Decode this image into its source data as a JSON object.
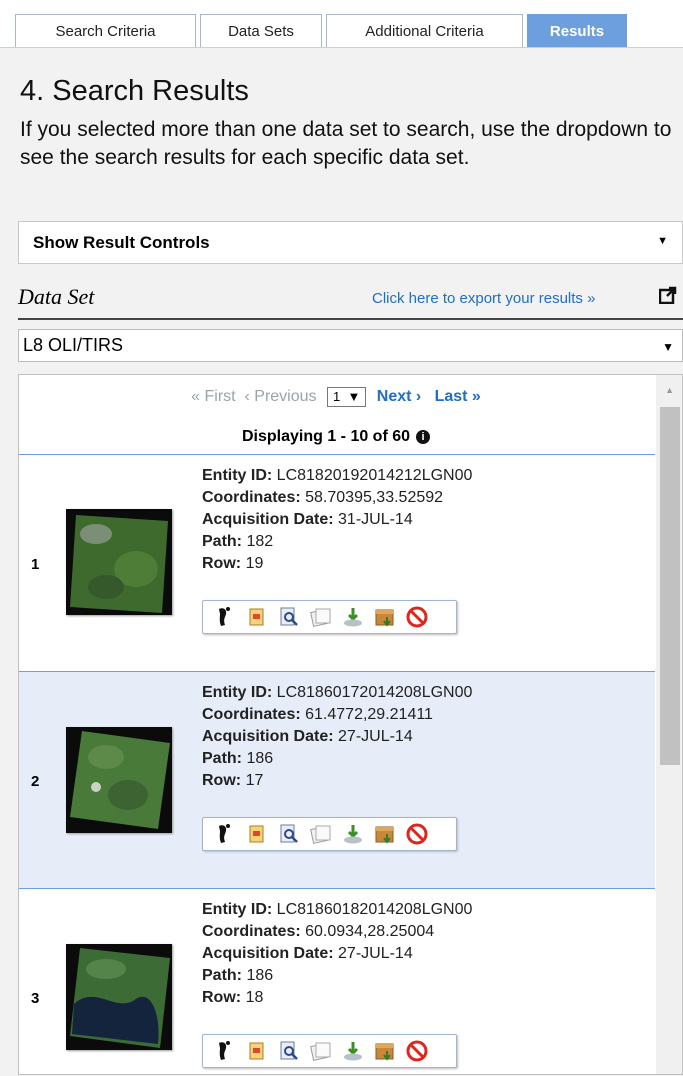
{
  "tabs": [
    {
      "label": "Search Criteria",
      "active": false
    },
    {
      "label": "Data Sets",
      "active": false
    },
    {
      "label": "Additional Criteria",
      "active": false
    },
    {
      "label": "Results",
      "active": true
    }
  ],
  "section": {
    "title": "4. Search Results",
    "description": "If you selected more than one data set to search, use the dropdown to see the search results for each specific data set."
  },
  "controls": {
    "label": "Show Result Controls"
  },
  "dataset": {
    "label": "Data Set",
    "export_link": "Click here to export your results »",
    "selected": "L8 OLI/TIRS"
  },
  "pager": {
    "first": "« First",
    "previous": "‹ Previous",
    "page": "1",
    "next": "Next ›",
    "last": "Last »",
    "displaying": "Displaying 1 - 10 of 60"
  },
  "field_labels": {
    "entity": "Entity ID:",
    "coordinates": "Coordinates:",
    "date": "Acquisition Date:",
    "path": "Path:",
    "row": "Row:"
  },
  "results": [
    {
      "num": "1",
      "entity_id": "LC81820192014212LGN00",
      "coordinates": "58.70395,33.52592",
      "date": "31-JUL-14",
      "path": "182",
      "row": "19"
    },
    {
      "num": "2",
      "entity_id": "LC81860172014208LGN00",
      "coordinates": "61.4772,29.21411",
      "date": "27-JUL-14",
      "path": "186",
      "row": "17"
    },
    {
      "num": "3",
      "entity_id": "LC81860182014208LGN00",
      "coordinates": "60.0934,28.25004",
      "date": "27-JUL-14",
      "path": "186",
      "row": "18"
    }
  ],
  "action_icons": [
    "footprint-icon",
    "metadata-icon",
    "browse-icon",
    "compare-icon",
    "download-icon",
    "bulk-download-icon",
    "exclude-icon"
  ],
  "colors": {
    "tab_active": "#6d9fde",
    "link": "#1f6ec7",
    "row_alt": "#e6edf8"
  }
}
